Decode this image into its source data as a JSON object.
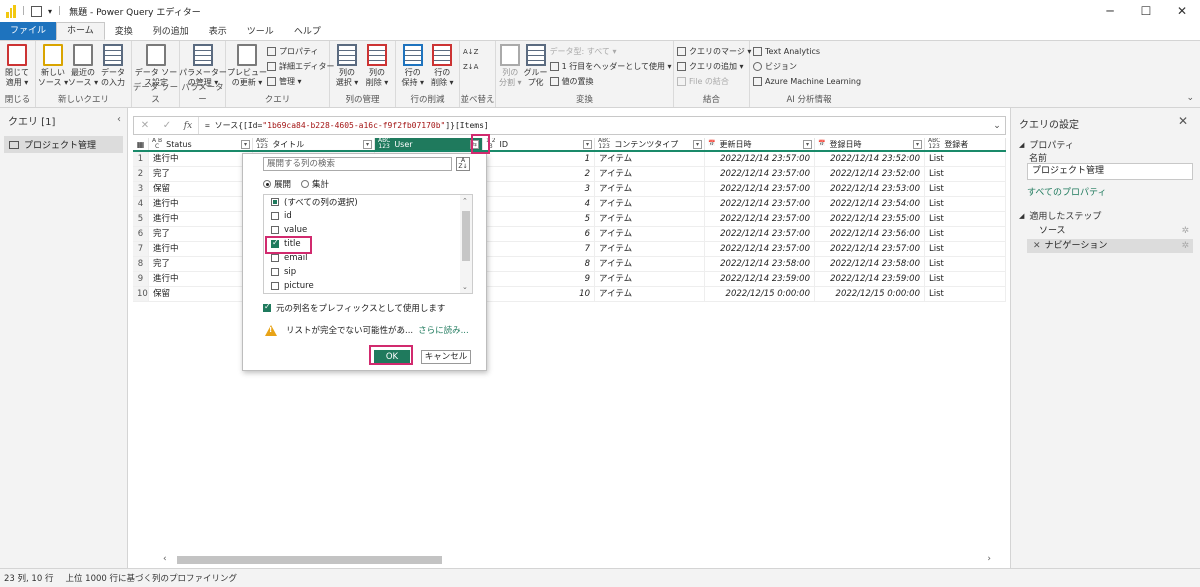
{
  "window": {
    "title": "無題 - Power Query エディター",
    "minimize": "─",
    "maximize": "☐",
    "close": "✕"
  },
  "tabs": [
    "ファイル",
    "ホーム",
    "変換",
    "列の追加",
    "表示",
    "ツール",
    "ヘルプ"
  ],
  "ribbon": {
    "close_group": {
      "btn": "閉じて\n適用 ▾",
      "label": "閉じる"
    },
    "newquery_group": {
      "b1": "新しい\nソース ▾",
      "b2": "最近の\nソース ▾",
      "b3": "データ\nの入力",
      "label": "新しいクエリ"
    },
    "datasource_group": {
      "b1": "データ ソー\nス設定",
      "label": "データ ソース"
    },
    "param_group": {
      "b1": "パラメーター\nの管理 ▾",
      "label": "パラメーター"
    },
    "query_group": {
      "b1": "プレビュー\nの更新 ▾",
      "s1": "プロパティ",
      "s2": "詳細エディター",
      "s3": "管理 ▾",
      "label": "クエリ"
    },
    "cols_group": {
      "b1": "列の\n選択 ▾",
      "b2": "列の\n削除 ▾",
      "label": "列の管理"
    },
    "rows_group": {
      "b1": "行の\n保持 ▾",
      "b2": "行の\n削除 ▾",
      "label": "行の削減"
    },
    "sort_group": {
      "label": "並べ替え"
    },
    "transform_group": {
      "b1": "列の\n分割 ▾",
      "b2": "グルー\nプ化",
      "s1": "データ型: すべて ▾",
      "s2": "1 行目をヘッダーとして使用 ▾",
      "s3": "値の置換",
      "label": "変換"
    },
    "combine_group": {
      "s1": "クエリのマージ ▾",
      "s2": "クエリの追加 ▾",
      "s3": "File の結合",
      "label": "結合"
    },
    "ai_group": {
      "s1": "Text Analytics",
      "s2": "ビジョン",
      "s3": "Azure Machine Learning",
      "label": "AI 分析情報"
    }
  },
  "queries": {
    "title": "クエリ [1]",
    "items": [
      "プロジェクト管理"
    ]
  },
  "formula": {
    "prefix": "= ソース{[Id=",
    "id": "\"1b69ca84-b228-4605-a16c-f9f2fb07170b\"",
    "suffix": "]}[Items]"
  },
  "grid": {
    "headers": [
      {
        "type": "A B\nC",
        "name": "Status"
      },
      {
        "type": "ABC\n123",
        "name": "タイトル"
      },
      {
        "type": "ABC\n123",
        "name": "User"
      },
      {
        "type": "1 2\n3",
        "name": "ID"
      },
      {
        "type": "ABC\n123",
        "name": "コンテンツタイプ"
      },
      {
        "type": "",
        "name": "更新日時"
      },
      {
        "type": "",
        "name": "登録日時"
      },
      {
        "type": "ABC\n123",
        "name": "登録者"
      }
    ],
    "rows": [
      {
        "n": "1",
        "status": "進行中",
        "id": "1",
        "ct": "アイテム",
        "mod": "2022/12/14 23:57:00",
        "cre": "2022/12/14 23:52:00",
        "by": "List"
      },
      {
        "n": "2",
        "status": "完了",
        "id": "2",
        "ct": "アイテム",
        "mod": "2022/12/14 23:57:00",
        "cre": "2022/12/14 23:52:00",
        "by": "List"
      },
      {
        "n": "3",
        "status": "保留",
        "id": "3",
        "ct": "アイテム",
        "mod": "2022/12/14 23:57:00",
        "cre": "2022/12/14 23:53:00",
        "by": "List"
      },
      {
        "n": "4",
        "status": "進行中",
        "id": "4",
        "ct": "アイテム",
        "mod": "2022/12/14 23:57:00",
        "cre": "2022/12/14 23:54:00",
        "by": "List"
      },
      {
        "n": "5",
        "status": "進行中",
        "id": "5",
        "ct": "アイテム",
        "mod": "2022/12/14 23:57:00",
        "cre": "2022/12/14 23:55:00",
        "by": "List"
      },
      {
        "n": "6",
        "status": "完了",
        "id": "6",
        "ct": "アイテム",
        "mod": "2022/12/14 23:57:00",
        "cre": "2022/12/14 23:56:00",
        "by": "List"
      },
      {
        "n": "7",
        "status": "進行中",
        "id": "7",
        "ct": "アイテム",
        "mod": "2022/12/14 23:57:00",
        "cre": "2022/12/14 23:57:00",
        "by": "List"
      },
      {
        "n": "8",
        "status": "完了",
        "id": "8",
        "ct": "アイテム",
        "mod": "2022/12/14 23:58:00",
        "cre": "2022/12/14 23:58:00",
        "by": "List"
      },
      {
        "n": "9",
        "status": "進行中",
        "id": "9",
        "ct": "アイテム",
        "mod": "2022/12/14 23:59:00",
        "cre": "2022/12/14 23:59:00",
        "by": "List"
      },
      {
        "n": "10",
        "status": "保留",
        "id": "10",
        "ct": "アイテム",
        "mod": "2022/12/15 0:00:00",
        "cre": "2022/12/15 0:00:00",
        "by": "List"
      }
    ]
  },
  "expand_popup": {
    "search_placeholder": "展開する列の検索",
    "radio_expand": "展開",
    "radio_aggregate": "集計",
    "options": [
      {
        "label": "(すべての列の選択)",
        "state": "partial"
      },
      {
        "label": "id",
        "state": "off"
      },
      {
        "label": "value",
        "state": "off"
      },
      {
        "label": "title",
        "state": "on"
      },
      {
        "label": "email",
        "state": "off"
      },
      {
        "label": "sip",
        "state": "off"
      },
      {
        "label": "picture",
        "state": "off"
      }
    ],
    "prefix_label": "元の列名をプレフィックスとして使用します",
    "warning": "リストが完全でない可能性があ...",
    "more_link": "さらに読み...",
    "ok": "OK",
    "cancel": "キャンセル"
  },
  "settings": {
    "title": "クエリの設定",
    "properties": "プロパティ",
    "name_label": "名前",
    "name_value": "プロジェクト管理",
    "all_props_link": "すべてのプロパティ",
    "applied_steps": "適用したステップ",
    "steps": [
      "ソース",
      "ナビゲーション"
    ]
  },
  "status": {
    "left": "23 列, 10 行",
    "right": "上位 1000 行に基づく列のプロファイリング"
  },
  "colors": {
    "accent": "#1f7a5d",
    "file_tab": "#1e73be",
    "highlight": "#d12a6e"
  }
}
